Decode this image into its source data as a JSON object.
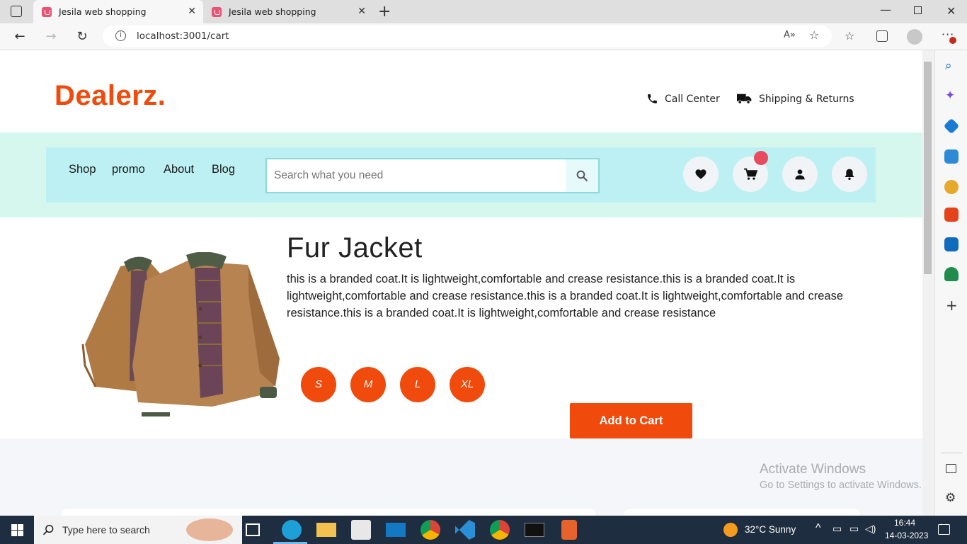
{
  "browser": {
    "tabs": [
      {
        "title": "Jesila web shopping",
        "active": true
      },
      {
        "title": "Jesila web shopping",
        "active": false
      }
    ],
    "url": "localhost:3001/cart"
  },
  "site": {
    "logo": "Dealerz.",
    "top_links": [
      {
        "label": "Call Center",
        "icon": "phone-icon"
      },
      {
        "label": "Shipping & Returns",
        "icon": "truck-icon"
      }
    ],
    "menu": [
      "Shop",
      "promo",
      "About",
      "Blog"
    ],
    "search_placeholder": "Search what you need",
    "action_icons": [
      "heart-icon",
      "cart-icon",
      "user-icon",
      "bell-icon"
    ]
  },
  "product": {
    "title": "Fur Jacket",
    "description": "this is a branded coat.It is lightweight,comfortable and crease resistance.this is a branded coat.It is lightweight,comfortable and crease resistance.this is a branded coat.It is lightweight,comfortable and crease resistance.this is a branded coat.It is lightweight,comfortable and crease resistance",
    "sizes": [
      "S",
      "M",
      "L",
      "XL"
    ],
    "add_to_cart": "Add to Cart"
  },
  "watermark": {
    "line1": "Activate Windows",
    "line2": "Go to Settings to activate Windows."
  },
  "taskbar": {
    "search_placeholder": "Type here to search",
    "weather": "32°C  Sunny",
    "time": "16:44",
    "date": "14-03-2023"
  },
  "colors": {
    "brand": "#f04a0c",
    "nav_bg": "#bdf0f3",
    "band_bg": "#d6f7ee",
    "badge": "#e84a5f"
  }
}
